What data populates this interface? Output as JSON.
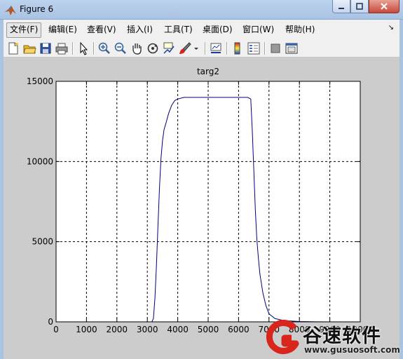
{
  "window": {
    "title": "Figure 6",
    "controls": [
      "minimize-icon",
      "maximize-icon",
      "close-icon"
    ]
  },
  "menu": {
    "items": [
      "文件(F)",
      "编辑(E)",
      "查看(V)",
      "插入(I)",
      "工具(T)",
      "桌面(D)",
      "窗口(W)",
      "帮助(H)"
    ],
    "active_index": 0
  },
  "toolbar": {
    "icons": [
      "new-figure-icon",
      "open-file-icon",
      "save-icon",
      "print-icon",
      "pointer-icon",
      "zoom-in-icon",
      "zoom-out-icon",
      "pan-hand-icon",
      "rotate-3d-icon",
      "data-cursor-icon",
      "brush-icon",
      "brush-dropdown-icon",
      "link-plot-icon",
      "colorbar-icon",
      "legend-icon",
      "hide-plot-tools-icon",
      "show-plot-tools-icon"
    ]
  },
  "chart_data": {
    "type": "line",
    "title": "targ2",
    "xlabel": "",
    "ylabel": "",
    "xlim": [
      0,
      10000
    ],
    "ylim": [
      0,
      15000
    ],
    "x_ticks": [
      "0",
      "1000",
      "2000",
      "3000",
      "4000",
      "5000",
      "6000",
      "7000",
      "8000",
      "9000",
      "10000"
    ],
    "y_ticks": [
      "0",
      "5000",
      "10000",
      "15000"
    ],
    "grid": true,
    "line_color": "#00007f",
    "series": [
      {
        "x": [
          0,
          3150,
          3200,
          3250,
          3300,
          3350,
          3400,
          3450,
          3500,
          3550,
          3600,
          3700,
          3800,
          3900,
          4000,
          4200,
          4500,
          5000,
          5500,
          6000,
          6300,
          6400,
          6450,
          6500,
          6550,
          6600,
          6650,
          6700,
          6800,
          6900,
          7000,
          7200,
          7500,
          8000,
          8500,
          9000,
          9500
        ],
        "y": [
          0,
          0,
          200,
          1500,
          3500,
          6000,
          8400,
          10200,
          11300,
          12000,
          12300,
          13000,
          13500,
          13800,
          13900,
          14000,
          14000,
          14000,
          14000,
          14000,
          14000,
          13900,
          12000,
          9500,
          7000,
          5200,
          4000,
          3000,
          1800,
          1000,
          500,
          200,
          80,
          20,
          5,
          0,
          0
        ]
      }
    ]
  },
  "watermark": {
    "name": "谷速软件",
    "url": "www.gusuosoft.com",
    "brand_color": "#d8261c"
  }
}
